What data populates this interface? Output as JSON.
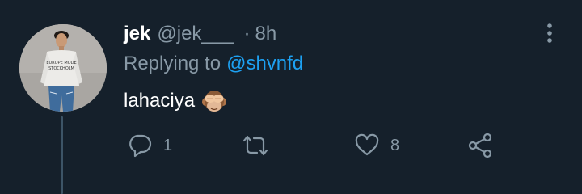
{
  "tweet": {
    "author_name": "jek",
    "author_handle": "@jek___",
    "separator": "·",
    "time": "8h",
    "replying_prefix": "Replying to",
    "replying_handle": "@shvnfd",
    "text": "lahaciya",
    "emoji": "see-no-evil-monkey",
    "avatar_shirt_text": [
      "EUROPE MODE",
      "STOCKHOLM"
    ]
  },
  "actions": {
    "reply_count": "1",
    "retweet_count": "",
    "like_count": "8"
  },
  "icons": {
    "more": "more-vertical-icon",
    "reply": "reply-bubble-icon",
    "retweet": "retweet-icon",
    "like": "heart-icon",
    "share": "share-icon"
  },
  "colors": {
    "background": "#15202b",
    "text": "#ffffff",
    "muted": "#8899a6",
    "link": "#1da1f2",
    "divider": "#38444d",
    "thread_line": "#3d5466"
  }
}
